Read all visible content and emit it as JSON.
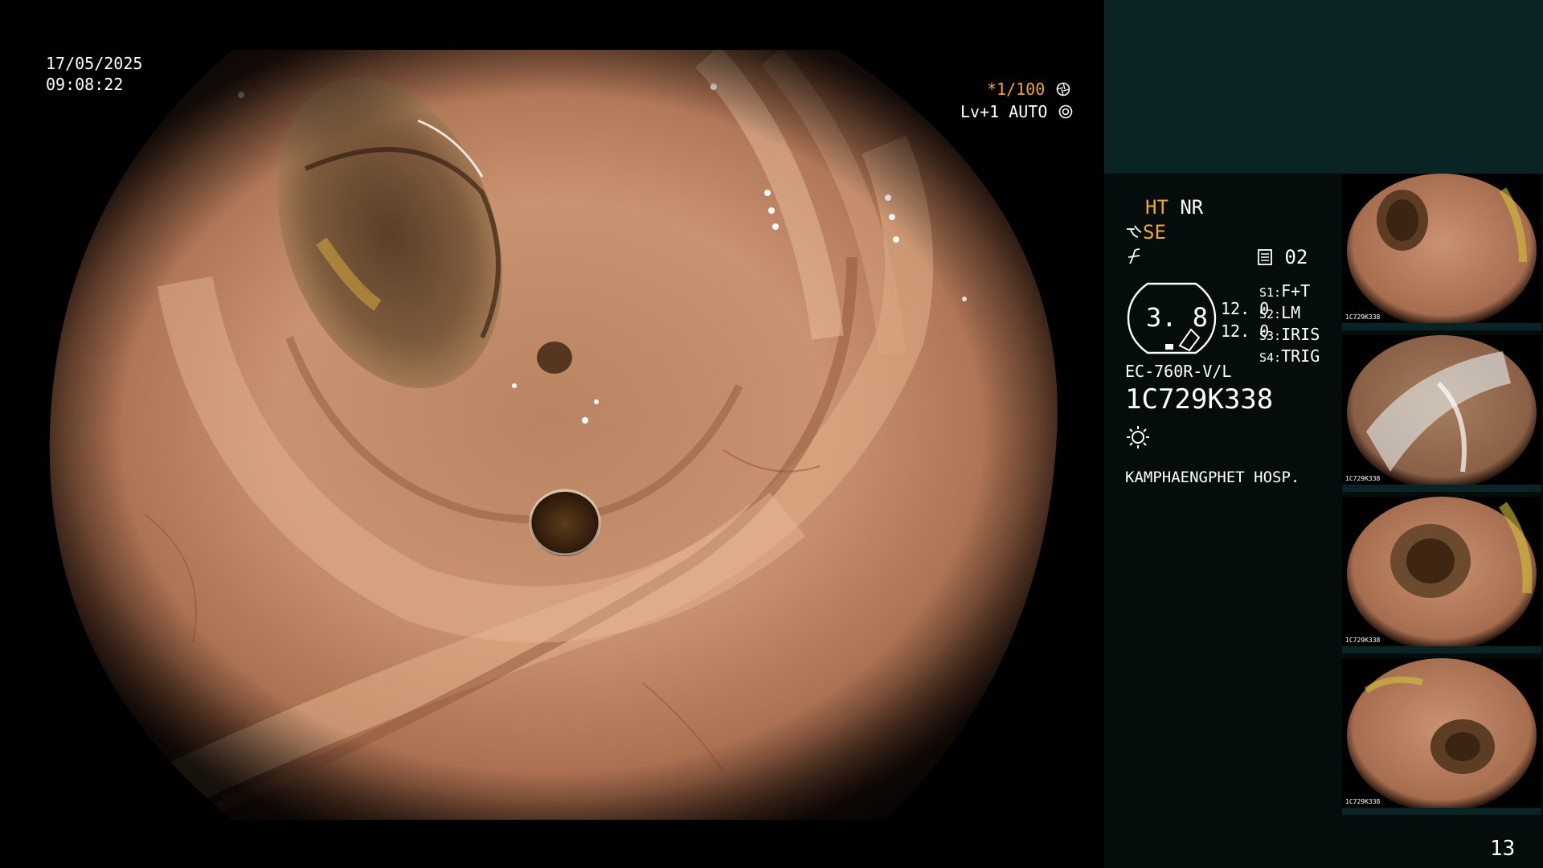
{
  "overlay": {
    "date": "17/05/2025",
    "time": "09:08:22",
    "shutter": "*1/100",
    "shutter_icon": "aperture-icon",
    "level": "Lv+1",
    "mode": "AUTO",
    "mode_icon": "iris-icon",
    "page_number": "13"
  },
  "panel": {
    "ht": "HT",
    "nr": "NR",
    "se": "SE",
    "se_icon": "enhance-icon",
    "freeze_icon": "freeze-icon",
    "record_icon": "memory-card-icon",
    "record_value": "02",
    "zoom_value": "3. 8",
    "val_top": "12. 0",
    "val_bottom": "12. 0",
    "switches": [
      {
        "key": "S1:",
        "value": "F+T"
      },
      {
        "key": "S2:",
        "value": "LM"
      },
      {
        "key": "S3:",
        "value": "IRIS"
      },
      {
        "key": "S4:",
        "value": "TRIG"
      }
    ],
    "scope_model": "EC-760R-V/L",
    "serial": "1C729K338",
    "light_icon": "light-source-icon",
    "hospital": "KAMPHAENGPHET HOSP."
  },
  "thumbnails": [
    {
      "label": "1C729K338"
    },
    {
      "label": "1C729K338"
    },
    {
      "label": "1C729K338"
    },
    {
      "label": "1C729K338"
    }
  ],
  "colors": {
    "accent_orange": "#f5a623",
    "panel_top": "#0a2324",
    "panel_bg": "#040d0b",
    "mucosa": "#c58a63"
  }
}
